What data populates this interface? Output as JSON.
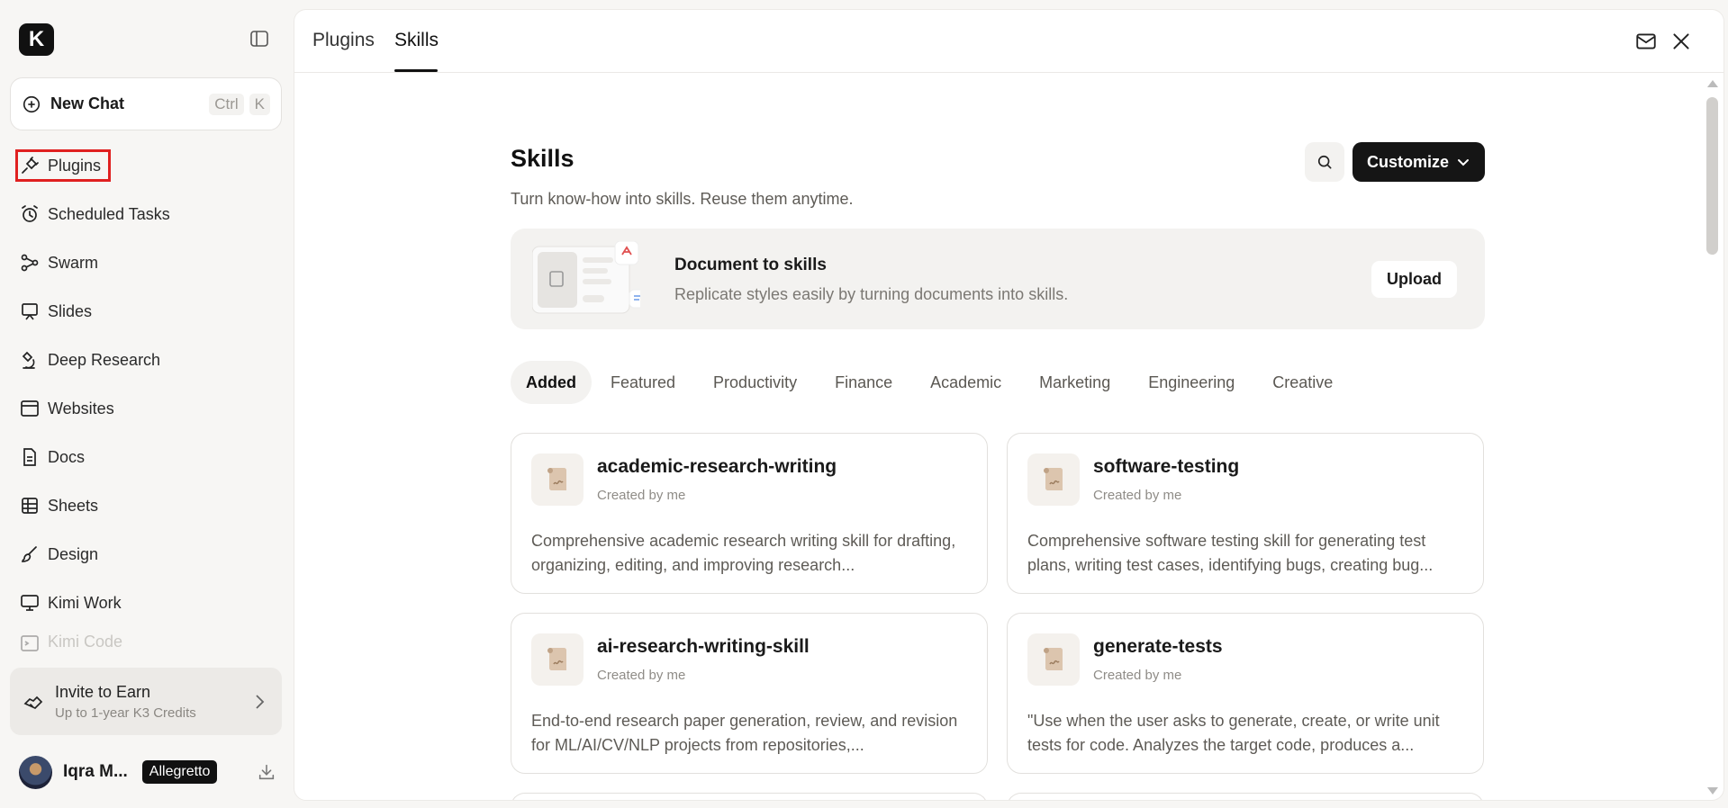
{
  "app": {
    "logo_letter": "K"
  },
  "new_chat": {
    "label": "New Chat",
    "shortcut": [
      "Ctrl",
      "K"
    ]
  },
  "sidebar": {
    "items": [
      {
        "label": "Plugins",
        "icon": "plug-icon"
      },
      {
        "label": "Scheduled Tasks",
        "icon": "alarm-clock-icon"
      },
      {
        "label": "Swarm",
        "icon": "swarm-icon"
      },
      {
        "label": "Slides",
        "icon": "presentation-icon"
      },
      {
        "label": "Deep Research",
        "icon": "microscope-icon"
      },
      {
        "label": "Websites",
        "icon": "browser-icon"
      },
      {
        "label": "Docs",
        "icon": "document-icon"
      },
      {
        "label": "Sheets",
        "icon": "table-icon"
      },
      {
        "label": "Design",
        "icon": "brush-icon"
      },
      {
        "label": "Kimi Work",
        "icon": "monitor-icon"
      },
      {
        "label": "Kimi Code",
        "icon": "terminal-icon"
      }
    ],
    "invite": {
      "title": "Invite to Earn",
      "subtitle": "Up to 1-year K3 Credits"
    },
    "user": {
      "name": "Iqra M...",
      "plan": "Allegretto"
    }
  },
  "topbar": {
    "tabs": [
      "Plugins",
      "Skills"
    ],
    "active_tab": "Skills"
  },
  "skills": {
    "title": "Skills",
    "subtitle": "Turn know-how into skills. Reuse them anytime.",
    "customize_label": "Customize",
    "doc_card": {
      "title": "Document to skills",
      "description": "Replicate styles easily by turning documents into skills.",
      "upload_label": "Upload"
    },
    "filters": [
      "Added",
      "Featured",
      "Productivity",
      "Finance",
      "Academic",
      "Marketing",
      "Engineering",
      "Creative"
    ],
    "active_filter": "Added",
    "cards": [
      {
        "title": "academic-research-writing",
        "creator": "Created by me",
        "description": "Comprehensive academic research writing skill for drafting, organizing, editing, and improving research..."
      },
      {
        "title": "software-testing",
        "creator": "Created by me",
        "description": "Comprehensive software testing skill for generating test plans, writing test cases, identifying bugs, creating bug..."
      },
      {
        "title": "ai-research-writing-skill",
        "creator": "Created by me",
        "description": "End-to-end research paper generation, review, and revision for ML/AI/CV/NLP projects from repositories,..."
      },
      {
        "title": "generate-tests",
        "creator": "Created by me",
        "description": "\"Use when the user asks to generate, create, or write unit tests for code. Analyzes the target code, produces a..."
      }
    ]
  },
  "colors": {
    "accent": "#151515",
    "highlight_box": "#e02020",
    "sidebar_bg": "#f7f6f4"
  }
}
